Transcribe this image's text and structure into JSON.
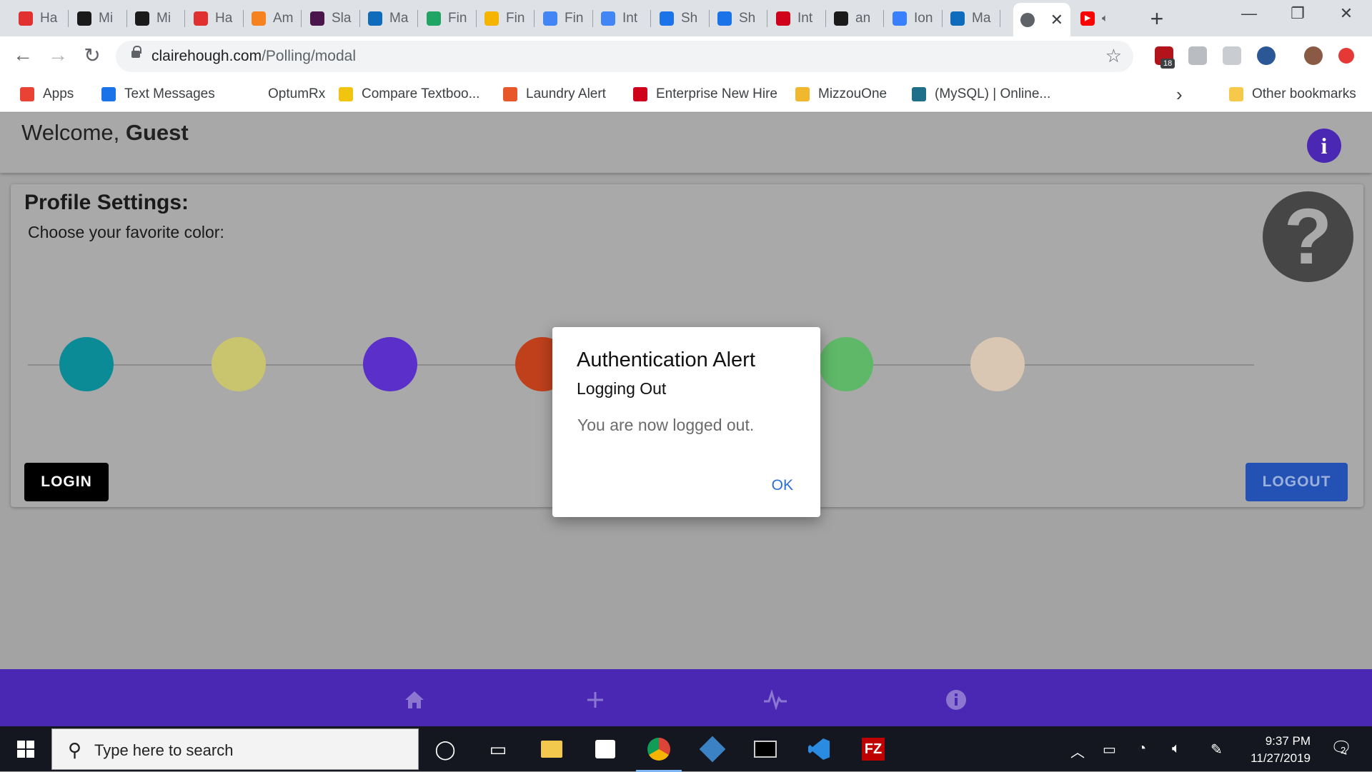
{
  "browser": {
    "tabs": [
      {
        "label": "Ha",
        "color": "#e0302f"
      },
      {
        "label": "Mi",
        "color": "#1a1a1a"
      },
      {
        "label": "Mi",
        "color": "#1a1a1a"
      },
      {
        "label": "Ha",
        "color": "#e0302f"
      },
      {
        "label": "Am",
        "color": "#f6821f"
      },
      {
        "label": "Sla",
        "color": "#4a154b"
      },
      {
        "label": "Ma",
        "color": "#0f6cbd"
      },
      {
        "label": "Fin",
        "color": "#1fa463"
      },
      {
        "label": "Fin",
        "color": "#f4b400"
      },
      {
        "label": "Fin",
        "color": "#4285f4"
      },
      {
        "label": "Int",
        "color": "#4285f4"
      },
      {
        "label": "Sh",
        "color": "#1a73e8"
      },
      {
        "label": "Sh",
        "color": "#1a73e8"
      },
      {
        "label": "Int",
        "color": "#d0021b"
      },
      {
        "label": "an",
        "color": "#1a1a1a"
      },
      {
        "label": "Ion",
        "color": "#3880ff"
      },
      {
        "label": "Ma",
        "color": "#0f6cbd"
      }
    ],
    "active_tab_icon": "globe-icon",
    "audio_tab_icon": "youtube-icon",
    "new_tab_label": "+",
    "url_host": "clairehough.com",
    "url_path": "/Polling/modal",
    "ext_badge": "18",
    "bookmarks": [
      {
        "label": "Apps",
        "color": "#ea4335"
      },
      {
        "label": "Text Messages",
        "color": "#1a73e8"
      },
      {
        "label": "OptumRx",
        "color": "#ffffff"
      },
      {
        "label": "Compare Textboo...",
        "color": "#f1c40f"
      },
      {
        "label": "Laundry Alert",
        "color": "#e8572a"
      },
      {
        "label": "Enterprise New Hire",
        "color": "#d0021b"
      },
      {
        "label": "MizzouOne",
        "color": "#f1b82d"
      },
      {
        "label": "(MySQL) | Online...",
        "color": "#1f6f8b"
      }
    ],
    "other_bookmarks": "Other bookmarks"
  },
  "page": {
    "welcome_prefix": "Welcome, ",
    "welcome_user": "Guest",
    "card_title": "Profile Settings:",
    "card_subtitle": "Choose your favorite color:",
    "colors": [
      "#0b8b96",
      "#c9c46e",
      "#5b2fc9",
      "#c0401c",
      "#c01f79",
      "#5fb868",
      "#d9c7b3"
    ],
    "login_label": "LOGIN",
    "logout_label": "LOGOUT",
    "help_symbol": "?",
    "info_symbol": "i"
  },
  "modal": {
    "title": "Authentication Alert",
    "subtitle": "Logging Out",
    "message": "You are now logged out.",
    "ok_label": "OK"
  },
  "tabnav": {
    "items": [
      "home-icon",
      "add-icon",
      "pulse-icon",
      "info-icon"
    ]
  },
  "taskbar": {
    "search_placeholder": "Type here to search",
    "time": "9:37 PM",
    "date": "11/27/2019",
    "notification_count": "2"
  }
}
